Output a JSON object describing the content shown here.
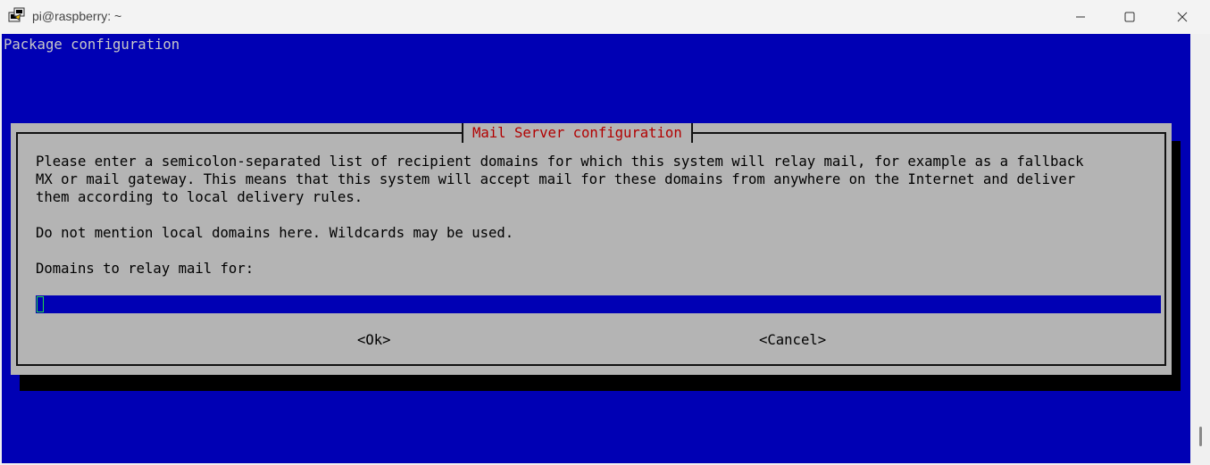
{
  "window": {
    "title": "pi@raspberry: ~",
    "icons": {
      "app": "putty-icon",
      "minimize": "minimize-icon",
      "maximize": "maximize-icon",
      "close": "close-icon"
    }
  },
  "terminal": {
    "background_color": "#0000b4",
    "header": "Package configuration"
  },
  "dialog": {
    "title": "Mail Server configuration",
    "title_color": "#b20000",
    "description": "Please enter a semicolon-separated list of recipient domains for which this system will relay mail, for example as a fallback\nMX or mail gateway. This means that this system will accept mail for these domains from anywhere on the Internet and deliver\nthem according to local delivery rules.",
    "note": "Do not mention local domains here. Wildcards may be used.",
    "prompt_label": "Domains to relay mail for:",
    "input_value": "",
    "buttons": {
      "ok": "<Ok>",
      "cancel": "<Cancel>"
    }
  }
}
